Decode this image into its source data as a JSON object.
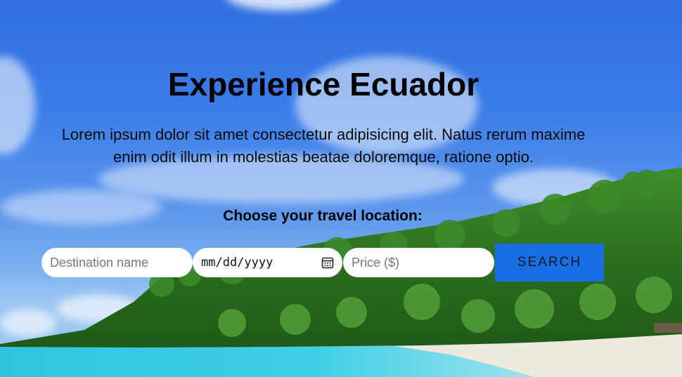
{
  "hero": {
    "title": "Experience Ecuador",
    "description": "Lorem ipsum dolor sit amet consectetur adipisicing elit. Natus rerum maxime enim odit illum in molestias beatae doloremque, ratione optio.",
    "prompt": "Choose your travel location:"
  },
  "form": {
    "destination_placeholder": "Destination name",
    "date_placeholder": "mm/dd/yyyy",
    "price_placeholder": "Price ($)",
    "search_label": "SEARCH"
  },
  "icons": {
    "calendar": "calendar-icon"
  },
  "colors": {
    "sky": "#3c7ee8",
    "search_button": "#1a6de2",
    "input_background": "#ffffff",
    "water": "#2ec4e0",
    "forest": "#2f7a25"
  }
}
